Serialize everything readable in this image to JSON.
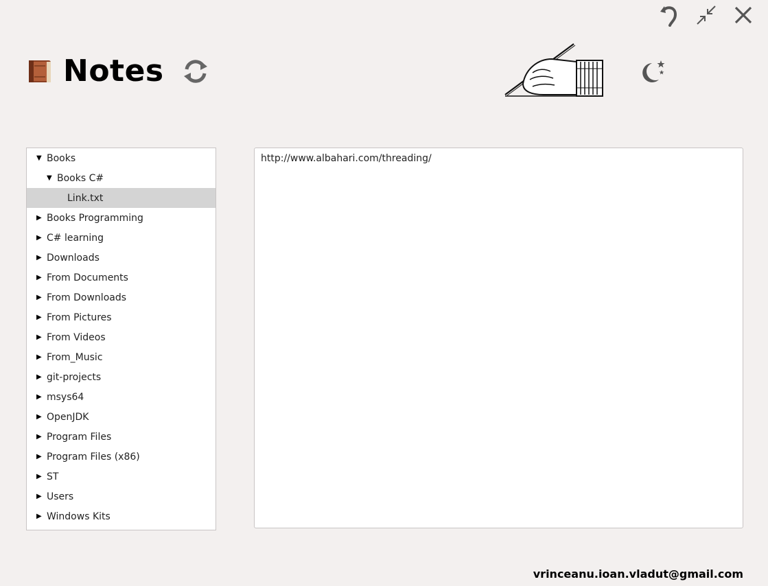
{
  "window": {
    "controls": [
      {
        "name": "undo-icon"
      },
      {
        "name": "restore-icon"
      },
      {
        "name": "close-icon"
      }
    ]
  },
  "header": {
    "title": "Notes",
    "app_icon": "book-icon",
    "refresh_icon": "refresh-icon",
    "illustration": "writing-hand-icon",
    "theme_icon": "moon-stars-icon"
  },
  "tree": {
    "items": [
      {
        "label": "Books",
        "expanded": true,
        "level": 0
      },
      {
        "label": "Books C#",
        "expanded": true,
        "level": 1
      },
      {
        "label": "Link.txt",
        "leaf": true,
        "level": 2,
        "selected": true
      },
      {
        "label": "Books Programming",
        "expanded": false,
        "level": 0
      },
      {
        "label": "C# learning",
        "expanded": false,
        "level": 0
      },
      {
        "label": "Downloads",
        "expanded": false,
        "level": 0
      },
      {
        "label": "From Documents",
        "expanded": false,
        "level": 0
      },
      {
        "label": "From Downloads",
        "expanded": false,
        "level": 0
      },
      {
        "label": "From Pictures",
        "expanded": false,
        "level": 0
      },
      {
        "label": "From Videos",
        "expanded": false,
        "level": 0
      },
      {
        "label": "From_Music",
        "expanded": false,
        "level": 0
      },
      {
        "label": "git-projects",
        "expanded": false,
        "level": 0
      },
      {
        "label": "msys64",
        "expanded": false,
        "level": 0
      },
      {
        "label": "OpenJDK",
        "expanded": false,
        "level": 0
      },
      {
        "label": "Program Files",
        "expanded": false,
        "level": 0
      },
      {
        "label": "Program Files (x86)",
        "expanded": false,
        "level": 0
      },
      {
        "label": "ST",
        "expanded": false,
        "level": 0
      },
      {
        "label": "Users",
        "expanded": false,
        "level": 0
      },
      {
        "label": "Windows Kits",
        "expanded": false,
        "level": 0
      }
    ]
  },
  "editor": {
    "content": "http://www.albahari.com/threading/"
  },
  "footer": {
    "email": "vrinceanu.ioan.vladut@gmail.com"
  },
  "colors": {
    "background": "#f3f0ef",
    "selected_row": "#d4d4d4",
    "panel_border": "#c8c4c4"
  }
}
